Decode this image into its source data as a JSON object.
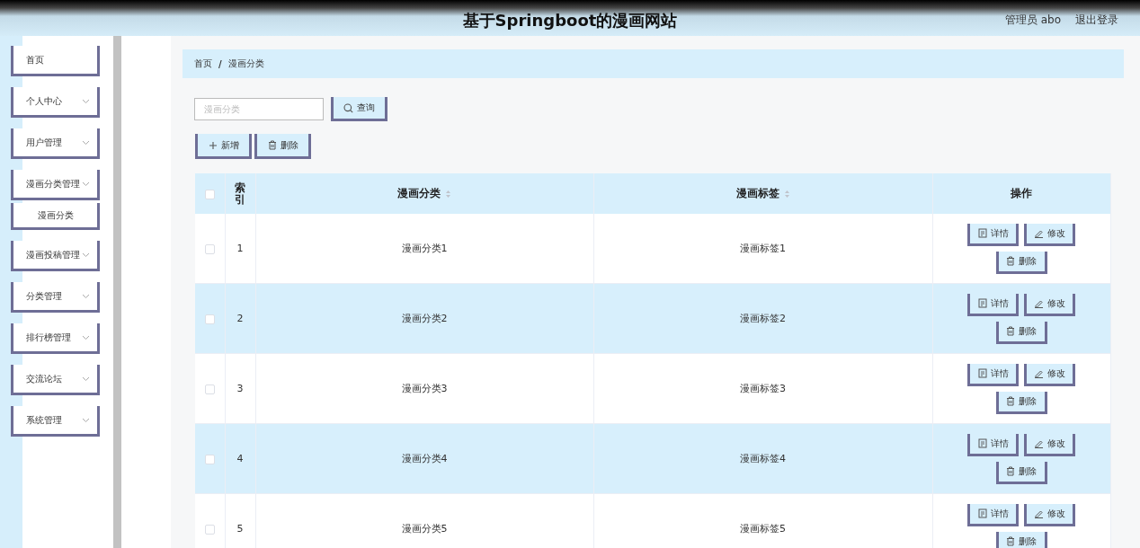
{
  "header": {
    "title": "基于Springboot的漫画网站",
    "user": "管理员 abo",
    "logout": "退出登录"
  },
  "sidebar": {
    "items": [
      {
        "label": "首页",
        "kind": "link"
      },
      {
        "label": "个人中心",
        "kind": "menu"
      },
      {
        "label": "用户管理",
        "kind": "menu"
      },
      {
        "label": "漫画分类管理",
        "kind": "menu",
        "children": [
          {
            "label": "漫画分类"
          }
        ]
      },
      {
        "label": "漫画投稿管理",
        "kind": "menu"
      },
      {
        "label": "分类管理",
        "kind": "menu"
      },
      {
        "label": "排行榜管理",
        "kind": "menu"
      },
      {
        "label": "交流论坛",
        "kind": "menu"
      },
      {
        "label": "系统管理",
        "kind": "menu"
      }
    ]
  },
  "breadcrumb": [
    "首页",
    "/",
    "漫画分类"
  ],
  "search": {
    "placeholder": "漫画分类",
    "button": "查询"
  },
  "actions": [
    "新增",
    "删除"
  ],
  "table": {
    "columns": [
      {
        "label": "索引",
        "sortable": false
      },
      {
        "label": "漫画分类",
        "sortable": true
      },
      {
        "label": "漫画标签",
        "sortable": true
      },
      {
        "label": "操作",
        "sortable": false
      }
    ],
    "header_checked": false,
    "rows": [
      {
        "checked": false,
        "index": "1",
        "category": "漫画分类1",
        "tag": "漫画标签1",
        "buttons": [
          "详情",
          "修改",
          "删除"
        ]
      },
      {
        "checked": false,
        "index": "2",
        "category": "漫画分类2",
        "tag": "漫画标签2",
        "buttons": [
          "详情",
          "修改",
          "删除"
        ]
      },
      {
        "checked": false,
        "index": "3",
        "category": "漫画分类3",
        "tag": "漫画标签3",
        "buttons": [
          "详情",
          "修改",
          "删除"
        ]
      },
      {
        "checked": false,
        "index": "4",
        "category": "漫画分类4",
        "tag": "漫画标签4",
        "buttons": [
          "详情",
          "修改",
          "删除"
        ]
      },
      {
        "checked": false,
        "index": "5",
        "category": "漫画分类5",
        "tag": "漫画标签5",
        "buttons": [
          "详情",
          "修改",
          "删除"
        ]
      }
    ]
  }
}
